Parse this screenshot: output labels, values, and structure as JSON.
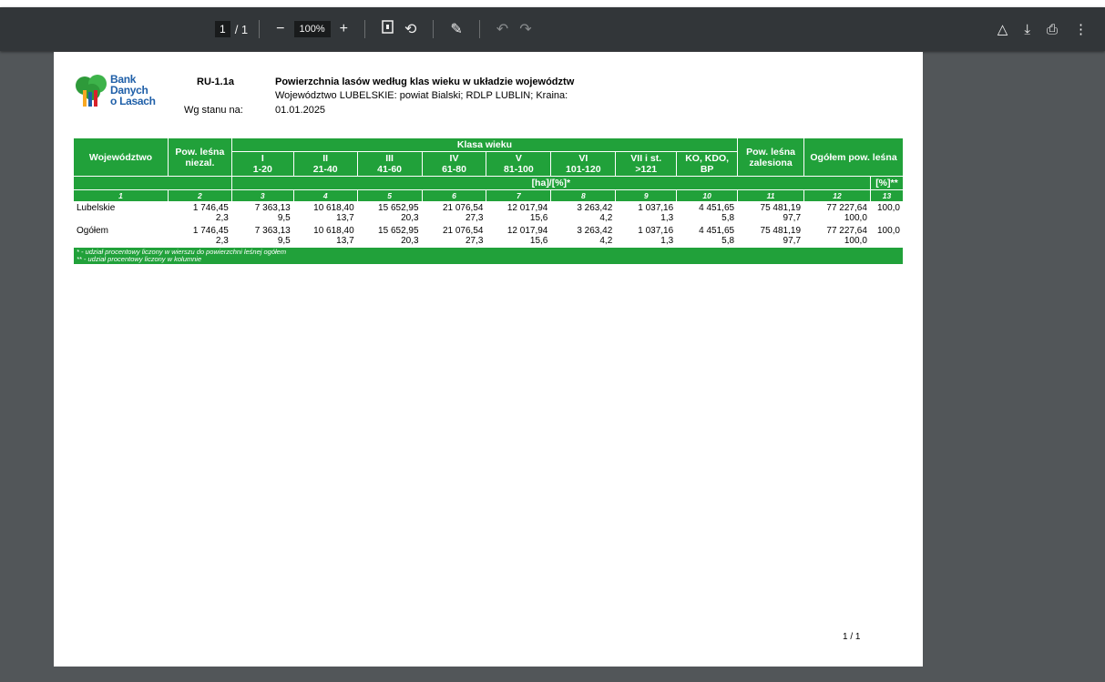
{
  "toolbar": {
    "page_current": "1",
    "page_sep": "/ 1",
    "zoom": "100%",
    "icons": [
      "zoom-out-icon",
      "zoom-in-icon",
      "fit-page-icon",
      "rotate-icon",
      "annotate-icon",
      "undo-icon",
      "redo-icon",
      "drive-icon",
      "download-icon",
      "print-icon",
      "more-icon"
    ]
  },
  "document": {
    "logo_line1": "Bank Danych",
    "logo_line2": "o Lasach",
    "code": "RU-1.1a",
    "title": "Powierzchnia lasów według klas wieku w układzie województw",
    "subtitle": "Województwo LUBELSKIE: powiat Bialski; RDLP LUBLIN; Kraina:",
    "wg_label": "Wg stanu na:",
    "wg_date": "01.01.2025",
    "page_footer": "1 / 1"
  },
  "table": {
    "h_woj": "Województwo",
    "h_niezal": "Pow. leśna niezal.",
    "h_klasa": "Klasa wieku",
    "classes": [
      {
        "roman": "I",
        "range": "1-20"
      },
      {
        "roman": "II",
        "range": "21-40"
      },
      {
        "roman": "III",
        "range": "41-60"
      },
      {
        "roman": "IV",
        "range": "61-80"
      },
      {
        "roman": "V",
        "range": "81-100"
      },
      {
        "roman": "VI",
        "range": "101-120"
      },
      {
        "roman": "VII i st.",
        "range": ">121"
      },
      {
        "roman": "KO, KDO,",
        "range": "BP"
      }
    ],
    "h_zalesiona": "Pow. leśna zalesiona",
    "h_ogolem": "Ogółem pow. leśna",
    "unit_ha": "[ha]/[%]*",
    "unit_pct": "[%]**",
    "col_numbers": [
      "1",
      "2",
      "3",
      "4",
      "5",
      "6",
      "7",
      "8",
      "9",
      "10",
      "11",
      "12",
      "13"
    ],
    "rows": [
      {
        "name": "Lubelskie",
        "vals": [
          "1 746,45",
          "7 363,13",
          "10 618,40",
          "15 652,95",
          "21 076,54",
          "12 017,94",
          "3 263,42",
          "1 037,16",
          "4 451,65",
          "75 481,19",
          "77 227,64"
        ],
        "pcts": [
          "2,3",
          "9,5",
          "13,7",
          "20,3",
          "27,3",
          "15,6",
          "4,2",
          "1,3",
          "5,8",
          "97,7",
          "100,0"
        ],
        "share": "100,0"
      },
      {
        "name": "Ogółem",
        "vals": [
          "1 746,45",
          "7 363,13",
          "10 618,40",
          "15 652,95",
          "21 076,54",
          "12 017,94",
          "3 263,42",
          "1 037,16",
          "4 451,65",
          "75 481,19",
          "77 227,64"
        ],
        "pcts": [
          "2,3",
          "9,5",
          "13,7",
          "20,3",
          "27,3",
          "15,6",
          "4,2",
          "1,3",
          "5,8",
          "97,7",
          "100,0"
        ],
        "share": "100,0"
      }
    ],
    "foot1": "* - udział procentowy liczony w wierszu do powierzchni leśnej ogółem",
    "foot2": "** - udział procentowy liczony w kolumnie"
  }
}
